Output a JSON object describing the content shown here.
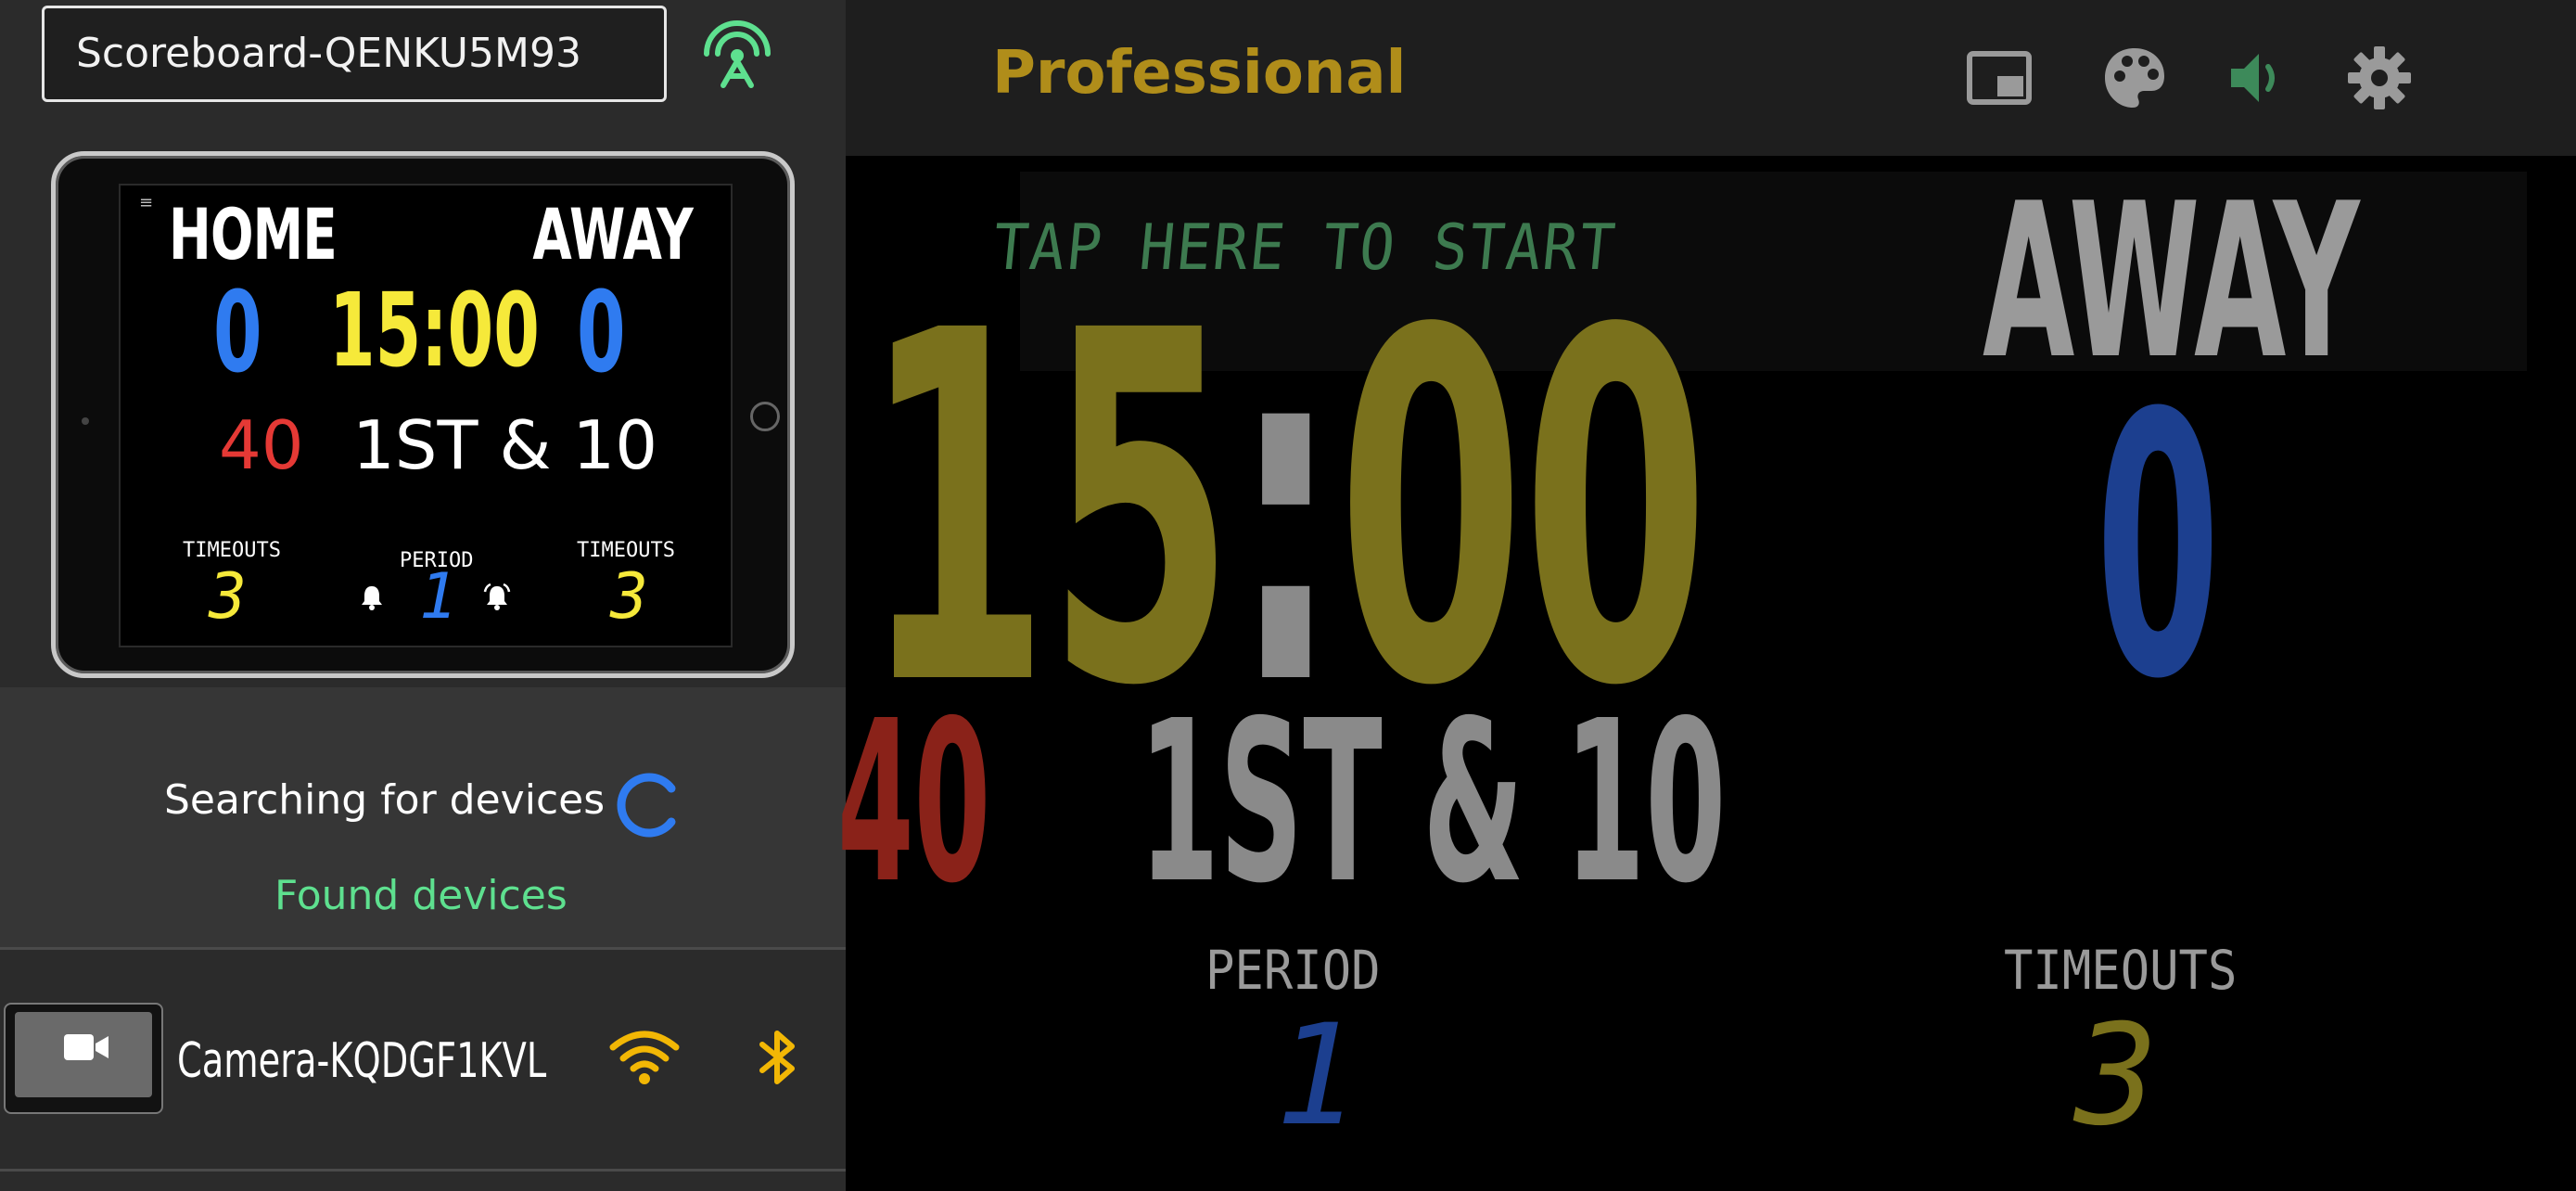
{
  "left_panel": {
    "scoreboard_name": "Scoreboard-QENKU5M93",
    "preview": {
      "menu_glyph": "≡",
      "home_label": "HOME",
      "away_label": "AWAY",
      "home_score": "0",
      "away_score": "0",
      "clock": "15:00",
      "ball_on": "40",
      "down_distance": "1ST & 10",
      "timeouts_label": "TIMEOUTS",
      "period_label": "PERIOD",
      "home_timeouts": "3",
      "period": "1",
      "away_timeouts": "3"
    },
    "searching_text": "Searching for devices",
    "found_text": "Found devices",
    "devices": [
      {
        "name": "Camera-KQDGF1KVL",
        "icons": [
          "wifi-icon",
          "bluetooth-icon"
        ]
      }
    ]
  },
  "topbar": {
    "mode_title": "Professional",
    "icons": [
      "picture-in-picture-icon",
      "palette-icon",
      "volume-icon",
      "gear-icon"
    ]
  },
  "scoreboard": {
    "tap_text": "TAP HERE TO START",
    "clock_minutes": "15",
    "clock_colon": ":",
    "clock_seconds": "00",
    "away_label": "AWAY",
    "away_score": "0",
    "ball_on": "40",
    "down_distance": "1ST & 10",
    "period_label": "PERIOD",
    "period": "1",
    "timeouts_label": "TIMEOUTS",
    "timeouts": "3"
  },
  "colors": {
    "accent_green": "#5ee08f",
    "spinner_blue": "#2f7bf0",
    "mode_gold": "#b08d1a",
    "wifi_gold": "#f2b705",
    "clock_dim": "#7a711c",
    "score_blue": "#1c3f8f",
    "ball_red": "#8a2219"
  }
}
